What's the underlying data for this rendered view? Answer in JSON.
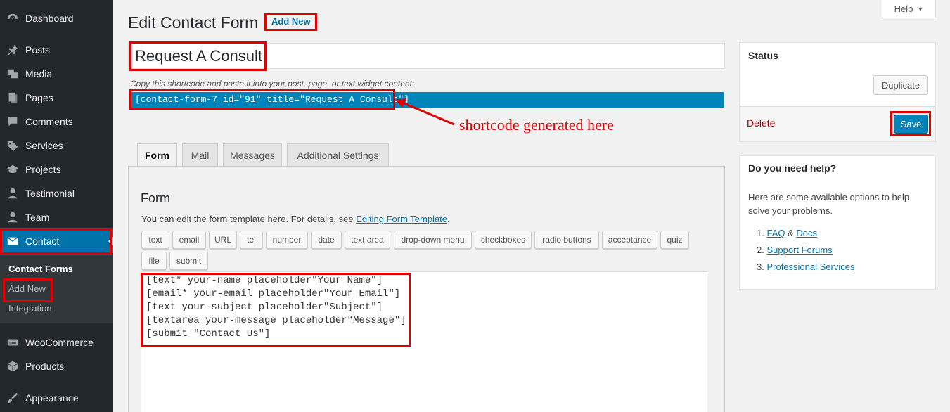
{
  "sidebar": {
    "items": [
      {
        "label": "Dashboard",
        "icon": "dashboard-icon"
      },
      {
        "label": "Posts",
        "icon": "pin-icon"
      },
      {
        "label": "Media",
        "icon": "media-icon"
      },
      {
        "label": "Pages",
        "icon": "pages-icon"
      },
      {
        "label": "Comments",
        "icon": "comment-icon"
      },
      {
        "label": "Services",
        "icon": "tag-icon"
      },
      {
        "label": "Projects",
        "icon": "graduation-icon"
      },
      {
        "label": "Testimonial",
        "icon": "person-icon"
      },
      {
        "label": "Team",
        "icon": "person-icon"
      },
      {
        "label": "Contact",
        "icon": "envelope-icon"
      },
      {
        "label": "WooCommerce",
        "icon": "woo-icon"
      },
      {
        "label": "Products",
        "icon": "box-icon"
      },
      {
        "label": "Appearance",
        "icon": "brush-icon"
      }
    ],
    "submenu": {
      "contact_forms": "Contact Forms",
      "add_new": "Add New",
      "integration": "Integration"
    }
  },
  "header": {
    "title": "Edit Contact Form",
    "add_new": "Add New",
    "help": "Help"
  },
  "form_title": "Request A Consult",
  "shortcode": {
    "hint": "Copy this shortcode and paste it into your post, page, or text widget content:",
    "value": "[contact-form-7 id=\"91\" title=\"Request A Consult\"]"
  },
  "annotation": "shortcode generated here",
  "tabs": [
    "Form",
    "Mail",
    "Messages",
    "Additional Settings"
  ],
  "form_panel": {
    "title": "Form",
    "desc_prefix": "You can edit the form template here. For details, see ",
    "desc_link": "Editing Form Template",
    "desc_suffix": ".",
    "tag_buttons": [
      "text",
      "email",
      "URL",
      "tel",
      "number",
      "date",
      "text area",
      "drop-down menu",
      "checkboxes",
      "radio buttons",
      "acceptance",
      "quiz",
      "file",
      "submit"
    ],
    "code_lines": [
      "[text* your-name placeholder\"Your Name\"]",
      "[email* your-email placeholder\"Your Email\"]",
      "[text your-subject placeholder\"Subject\"]",
      "[textarea your-message placeholder\"Message\"]",
      "[submit \"Contact Us\"]"
    ]
  },
  "status_box": {
    "title": "Status",
    "duplicate": "Duplicate",
    "delete": "Delete",
    "save": "Save"
  },
  "help_box": {
    "title": "Do you need help?",
    "text": "Here are some available options to help solve your problems.",
    "items": [
      {
        "num": "1.",
        "link1": "FAQ",
        "sep": " & ",
        "link2": "Docs"
      },
      {
        "num": "2.",
        "link1": "Support Forums"
      },
      {
        "num": "3.",
        "link1": "Professional Services"
      }
    ]
  },
  "colors": {
    "sidebar_bg": "#23282d",
    "accent": "#0073aa",
    "highlight_red": "#e00000"
  }
}
